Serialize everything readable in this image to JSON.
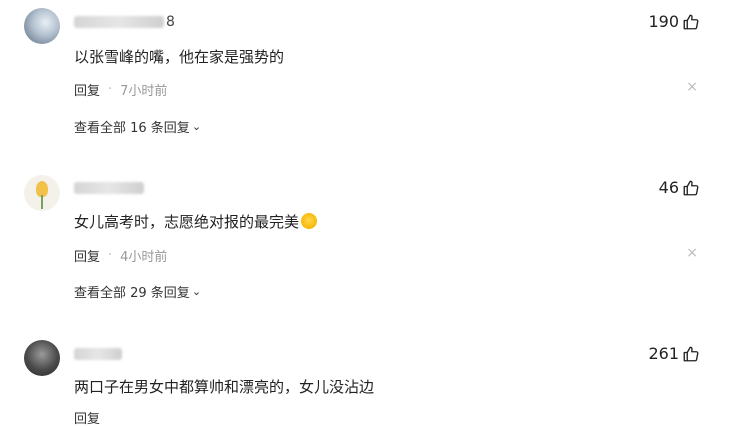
{
  "comments": [
    {
      "username_tail": "8",
      "likes": "190",
      "text": "以张雪峰的嘴，他在家是强势的",
      "reply_label": "回复",
      "dot": "·",
      "time": "7小时前",
      "close_glyph": "×",
      "view_replies": "查看全部 16 条回复",
      "chevron": "⌄"
    },
    {
      "username_tail": "",
      "likes": "46",
      "text": "女儿高考时，志愿绝对报的最完美",
      "reply_label": "回复",
      "dot": "·",
      "time": "4小时前",
      "close_glyph": "×",
      "view_replies": "查看全部 29 条回复",
      "chevron": "⌄"
    },
    {
      "username_tail": "",
      "likes": "261",
      "text": "两口子在男女中都算帅和漂亮的，女儿没沾边",
      "reply_label": "回复",
      "chevron": "⌄"
    }
  ],
  "icons": {
    "like": "thumbs-up-icon",
    "close": "close-icon",
    "emoji": "grinning-face-emoji-icon"
  }
}
